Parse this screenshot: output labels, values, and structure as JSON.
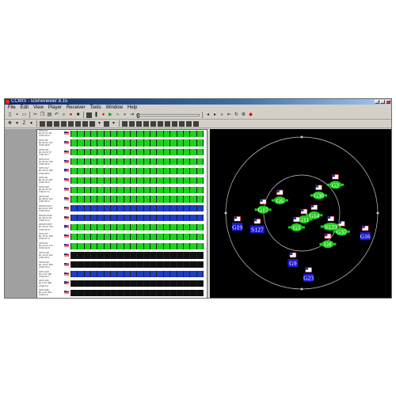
{
  "window": {
    "title": "CCMIS - sceneviewer 8.15"
  },
  "menubar": {
    "items": [
      "File",
      "Edit",
      "View",
      "Player",
      "Receiver",
      "Tools",
      "Window",
      "Help"
    ]
  },
  "toolbar": {
    "zoom_value": "Z"
  },
  "colors": {
    "signal_green": "#1ed21e",
    "signal_blue": "#1e3cc8",
    "signal_empty": "#101010",
    "sky_bg": "#000000",
    "sky_ring": "#c8c8c8",
    "sat_green": "#22cc22",
    "sat_blue": "#1a1ad4"
  },
  "signals": {
    "rows": [
      {
        "label": [
          "GPS G2",
          "EL 57 Az 96",
          "C/N0 49.3"
        ],
        "status": "green"
      },
      {
        "label": [
          "GPS G8",
          "EL 66 Az 217",
          "C/N0 48.8"
        ],
        "status": "green"
      },
      {
        "label": [
          "GPS G11",
          "EL 44 Az 17",
          "C/N0 43.7"
        ],
        "status": "green"
      },
      {
        "label": [
          "GPS G14",
          "EL 60 Az 313",
          "C/N0 48.5"
        ],
        "status": "green"
      },
      {
        "label": [
          "GPS G17",
          "EL 33 Az 326",
          "C/N0 48.2"
        ],
        "status": "green"
      },
      {
        "label": [
          "GPS G6",
          "EL 51 Az 207",
          "C/N0 46.6"
        ],
        "status": "green"
      },
      {
        "label": [
          "GPS G30",
          "EL 61 Az 44",
          "C/N0 47.4"
        ],
        "status": "green"
      },
      {
        "label": [
          "GPS G32",
          "EL 28 Az 121",
          "C/N0 39.3"
        ],
        "status": "green"
      },
      {
        "label": [
          "WAAS S127",
          "EL 24 Az 227",
          "C/N0 39.6"
        ],
        "status": "blue"
      },
      {
        "label": [
          "WAAS S133",
          "EL 30 Az 44",
          "C/N0 41.0"
        ],
        "status": "blue"
      },
      {
        "label": [
          "WAAS S137",
          "EL 40 Az 172",
          "C/N0 40.5"
        ],
        "status": "green"
      },
      {
        "label": [
          "GPS G3",
          "EL 75 Az 156",
          "C/N0 47.2"
        ],
        "status": "green"
      },
      {
        "label": [
          "GPS G9",
          "EL 14 Az 171",
          "C/N0 34.8"
        ],
        "status": "green"
      },
      {
        "label": [
          "GPS G16",
          "EL 14 Az 121",
          "C/N0 35.1"
        ],
        "status": "empty"
      },
      {
        "label": [
          "GPS G19",
          "EL 13 Az 266",
          "C/N0 33.4"
        ],
        "status": "empty"
      },
      {
        "label": [
          "GPS G23",
          "EL 5 Az 182",
          "C/N0 29.7"
        ],
        "status": "blue"
      },
      {
        "label": [
          "GPS G31",
          "EL 8 Az 305",
          "C/N0 0.0"
        ],
        "status": "empty"
      },
      {
        "label": [
          "GPS G25",
          "EL 3 Az 344",
          "C/N0 0.0"
        ],
        "status": "empty"
      }
    ],
    "bar_count": 20
  },
  "skyplot": {
    "satellites": [
      {
        "label": "G30",
        "type": "green",
        "elev": 61,
        "az": 44
      },
      {
        "label": "G2",
        "type": "green",
        "elev": 38,
        "az": 50
      },
      {
        "label": "G14",
        "type": "green",
        "elev": 75,
        "az": 100
      },
      {
        "label": "G6",
        "type": "green",
        "elev": 60,
        "az": 300
      },
      {
        "label": "G11",
        "type": "green",
        "elev": 82,
        "az": 160
      },
      {
        "label": "G17",
        "type": "green",
        "elev": 44,
        "az": 275
      },
      {
        "label": "G3",
        "type": "green",
        "elev": 72,
        "az": 200
      },
      {
        "label": "S133",
        "type": "green",
        "elev": 52,
        "az": 115
      },
      {
        "label": "G32",
        "type": "green",
        "elev": 38,
        "az": 115
      },
      {
        "label": "G8",
        "type": "green",
        "elev": 42,
        "az": 140
      },
      {
        "label": "S127",
        "type": "blue",
        "elev": 34,
        "az": 250
      },
      {
        "label": "G19",
        "type": "blue",
        "elev": 12,
        "az": 258
      },
      {
        "label": "G16",
        "type": "blue",
        "elev": 10,
        "az": 110
      },
      {
        "label": "G9",
        "type": "blue",
        "elev": 30,
        "az": 190
      },
      {
        "label": "G23",
        "type": "blue",
        "elev": 13,
        "az": 174
      }
    ]
  }
}
